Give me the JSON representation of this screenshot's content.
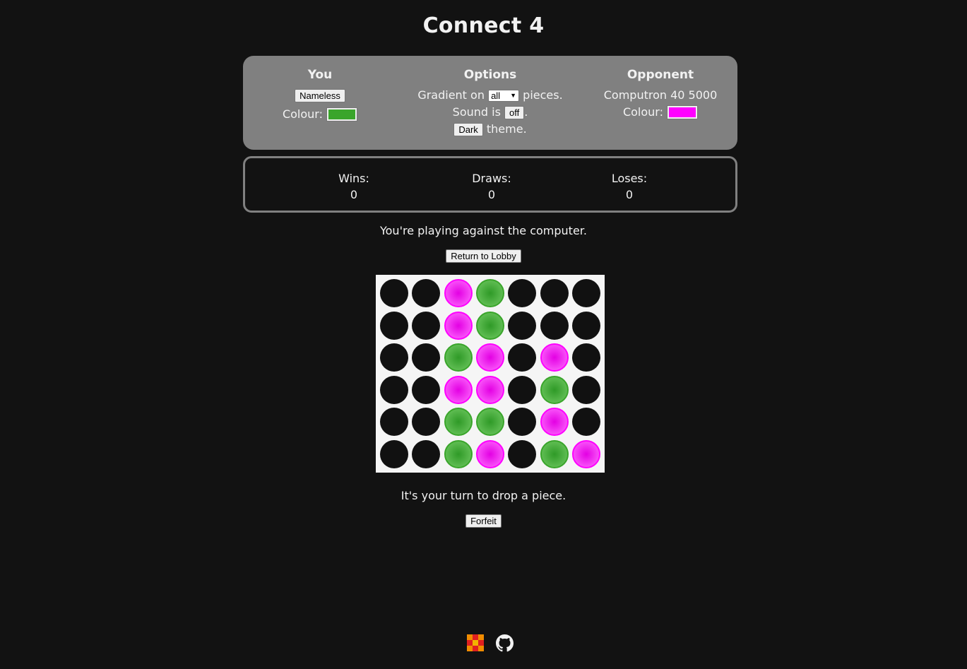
{
  "title": "Connect 4",
  "you": {
    "heading": "You",
    "name_button": "Nameless",
    "colour_label": "Colour:",
    "colour": "#3aa52b"
  },
  "options": {
    "heading": "Options",
    "gradient_prefix": "Gradient on",
    "gradient_value": "all",
    "gradient_suffix": "pieces.",
    "sound_prefix": "Sound is",
    "sound_value": "off",
    "sound_suffix": ".",
    "theme_button": "Dark",
    "theme_suffix": "theme."
  },
  "opponent": {
    "heading": "Opponent",
    "name": "Computron 40 5000",
    "colour_label": "Colour:",
    "colour": "#ff00ff"
  },
  "stats": {
    "wins_label": "Wins:",
    "wins": "0",
    "draws_label": "Draws:",
    "draws": "0",
    "loses_label": "Loses:",
    "loses": "0"
  },
  "status_top": "You're playing against the computer.",
  "lobby_button": "Return to Lobby",
  "board": [
    "..21...",
    "..21...",
    "..12.2.",
    "..22.1.",
    "..11.2.",
    "..12.12"
  ],
  "status_bottom": "It's your turn to drop a piece.",
  "forfeit_button": "Forfeit",
  "footer": {
    "icons": [
      "app-logo-icon",
      "github-icon"
    ]
  }
}
